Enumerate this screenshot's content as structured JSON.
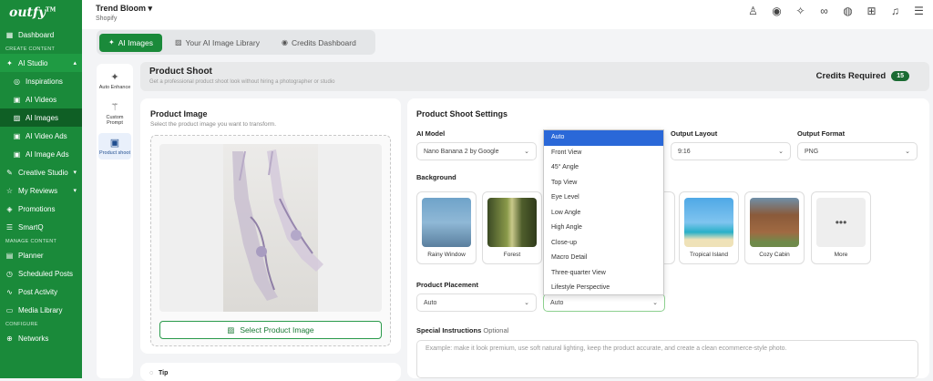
{
  "brand": {
    "logo": "outfy",
    "tm": "TM"
  },
  "store": {
    "name": "Trend Bloom",
    "platform": "Shopify"
  },
  "sidebar": {
    "items": [
      {
        "label": "Dashboard",
        "icon": "grid-icon"
      },
      {
        "section": "CREATE CONTENT"
      },
      {
        "label": "AI Studio",
        "icon": "ai-icon"
      },
      {
        "label": "Inspirations",
        "icon": "target-icon"
      },
      {
        "label": "AI Videos",
        "icon": "video-icon"
      },
      {
        "label": "AI Images",
        "icon": "image-icon"
      },
      {
        "label": "AI Video Ads",
        "icon": "video-ad-icon"
      },
      {
        "label": "AI Image Ads",
        "icon": "image-ad-icon"
      },
      {
        "label": "Creative Studio",
        "icon": "palette-icon"
      },
      {
        "label": "My Reviews",
        "icon": "star-icon"
      },
      {
        "label": "Promotions",
        "icon": "megaphone-icon"
      },
      {
        "label": "SmartQ",
        "icon": "queue-icon"
      },
      {
        "section": "MANAGE CONTENT"
      },
      {
        "label": "Planner",
        "icon": "calendar-icon"
      },
      {
        "label": "Scheduled Posts",
        "icon": "clock-icon"
      },
      {
        "label": "Post Activity",
        "icon": "activity-icon"
      },
      {
        "label": "Media Library",
        "icon": "folder-icon"
      },
      {
        "section": "CONFIGURE"
      },
      {
        "label": "Networks",
        "icon": "network-icon"
      }
    ]
  },
  "tabs": [
    {
      "label": "AI Images"
    },
    {
      "label": "Your AI Image Library"
    },
    {
      "label": "Credits Dashboard"
    }
  ],
  "tools": [
    {
      "label": "Auto Enhance"
    },
    {
      "label": "Custom Prompt"
    },
    {
      "label": "Product shoot"
    }
  ],
  "page": {
    "title": "Product Shoot",
    "description": "Get a professional product shoot look without hiring a photographer or studio",
    "credits_label": "Credits Required",
    "credits_value": "15"
  },
  "product_image": {
    "title": "Product Image",
    "subtitle": "Select the product image you want to transform.",
    "button": "Select Product Image",
    "tip": "Tip"
  },
  "settings": {
    "title": "Product Shoot Settings",
    "ai_model_label": "AI Model",
    "ai_model_value": "Nano Banana 2 by Google",
    "output_layout_label": "Output Layout",
    "output_layout_value": "9:16",
    "output_format_label": "Output Format",
    "output_format_value": "PNG",
    "background_label": "Background",
    "backgrounds": [
      "Rainy Window",
      "Forest",
      "Tropical Island",
      "Cozy Cabin",
      "More"
    ],
    "placement_label": "Product Placement",
    "placement_value": "Auto",
    "angle_value": "Auto",
    "special_label": "Special Instructions",
    "special_optional": "Optional",
    "special_placeholder": "Example: make it look premium, use soft natural lighting, keep the product accurate, and create a clean ecommerce-style photo."
  },
  "angle_dropdown": {
    "options": [
      "Auto",
      "Front View",
      "45° Angle",
      "Top View",
      "Eye Level",
      "Low Angle",
      "High Angle",
      "Close-up",
      "Macro Detail",
      "Three-quarter View",
      "Lifestyle Perspective"
    ],
    "selected": "Auto"
  },
  "colors": {
    "brand_green": "#1a8a3a",
    "dropdown_highlight": "#2a68d8"
  }
}
